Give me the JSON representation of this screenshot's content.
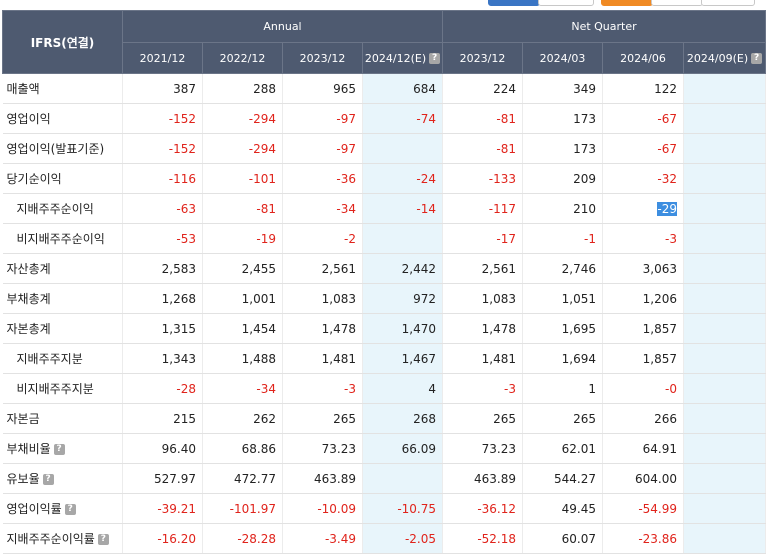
{
  "header": {
    "corner": "IFRS(연결)",
    "group_annual": "Annual",
    "group_quarter": "Net Quarter",
    "periods": [
      "2021/12",
      "2022/12",
      "2023/12",
      "2024/12(E)",
      "2023/12",
      "2024/03",
      "2024/06",
      "2024/09(E)"
    ],
    "help_glyph": "?"
  },
  "rows": [
    {
      "label": "매출액",
      "values": [
        "387",
        "288",
        "965",
        "684",
        "224",
        "349",
        "122",
        ""
      ]
    },
    {
      "label": "영업이익",
      "values": [
        "-152",
        "-294",
        "-97",
        "-74",
        "-81",
        "173",
        "-67",
        ""
      ]
    },
    {
      "label": "영업이익(발표기준)",
      "values": [
        "-152",
        "-294",
        "-97",
        "",
        "-81",
        "173",
        "-67",
        ""
      ]
    },
    {
      "label": "당기순이익",
      "values": [
        "-116",
        "-101",
        "-36",
        "-24",
        "-133",
        "209",
        "-32",
        ""
      ]
    },
    {
      "label": "지배주주순이익",
      "values": [
        "-63",
        "-81",
        "-34",
        "-14",
        "-117",
        "210",
        "-29",
        ""
      ]
    },
    {
      "label": "비지배주주순이익",
      "values": [
        "-53",
        "-19",
        "-2",
        "",
        "-17",
        "-1",
        "-3",
        ""
      ]
    },
    {
      "label": "자산총계",
      "values": [
        "2,583",
        "2,455",
        "2,561",
        "2,442",
        "2,561",
        "2,746",
        "3,063",
        ""
      ]
    },
    {
      "label": "부채총계",
      "values": [
        "1,268",
        "1,001",
        "1,083",
        "972",
        "1,083",
        "1,051",
        "1,206",
        ""
      ]
    },
    {
      "label": "자본총계",
      "values": [
        "1,315",
        "1,454",
        "1,478",
        "1,470",
        "1,478",
        "1,695",
        "1,857",
        ""
      ]
    },
    {
      "label": "지배주주지분",
      "values": [
        "1,343",
        "1,488",
        "1,481",
        "1,467",
        "1,481",
        "1,694",
        "1,857",
        ""
      ]
    },
    {
      "label": "비지배주주지분",
      "values": [
        "-28",
        "-34",
        "-3",
        "4",
        "-3",
        "1",
        "-0",
        ""
      ]
    },
    {
      "label": "자본금",
      "values": [
        "215",
        "262",
        "265",
        "268",
        "265",
        "265",
        "266",
        ""
      ]
    },
    {
      "label": "부채비율",
      "values": [
        "96.40",
        "68.86",
        "73.23",
        "66.09",
        "73.23",
        "62.01",
        "64.91",
        ""
      ]
    },
    {
      "label": "유보율",
      "values": [
        "527.97",
        "472.77",
        "463.89",
        "",
        "463.89",
        "544.27",
        "604.00",
        ""
      ]
    },
    {
      "label": "영업이익률",
      "values": [
        "-39.21",
        "-101.97",
        "-10.09",
        "-10.75",
        "-36.12",
        "49.45",
        "-54.99",
        ""
      ]
    },
    {
      "label": "지배주주순이익률",
      "values": [
        "-16.20",
        "-28.28",
        "-3.49",
        "-2.05",
        "-52.18",
        "60.07",
        "-23.86",
        ""
      ]
    }
  ],
  "colors": {
    "header_bg": "#4e5a70",
    "negative": "#e0231b",
    "estimate_bg": "#e8f5fb",
    "selection": "#3d8ee0"
  }
}
